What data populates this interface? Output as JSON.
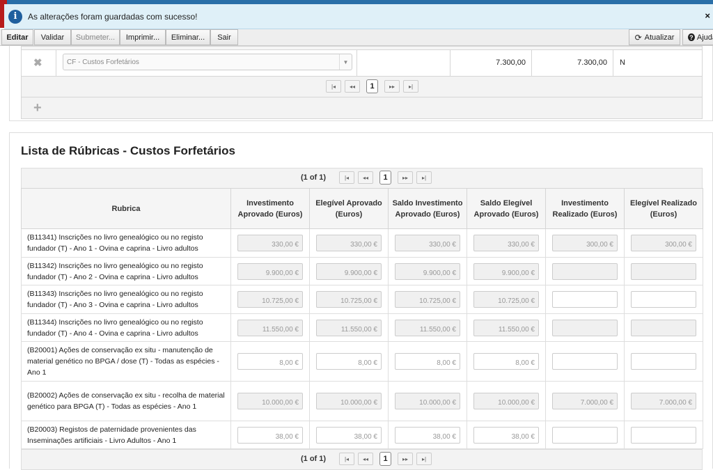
{
  "notification": {
    "message": "As alterações foram guardadas com sucesso!",
    "close": "×"
  },
  "toolbar": {
    "edit": "Editar",
    "validate": "Validar",
    "submit": "Submeter...",
    "print": "Imprimir...",
    "delete": "Eliminar...",
    "exit": "Sair",
    "refresh": "Atualizar",
    "help": "Ajuda"
  },
  "top_table": {
    "select_value": "CF - Custos Forfetários",
    "value_1": "7.300,00",
    "value_2": "7.300,00",
    "flag": "N",
    "pager": {
      "first": "|◂",
      "prev": "◂◂",
      "page": "1",
      "next": "▸▸",
      "last": "▸|"
    }
  },
  "section": {
    "title": "Lista de Rúbricas - Custos Forfetários"
  },
  "pager": {
    "label": "(1 of 1)",
    "first": "|◂",
    "prev": "◂◂",
    "page": "1",
    "next": "▸▸",
    "last": "▸|"
  },
  "grid": {
    "columns": [
      {
        "label": "Rubrica"
      },
      {
        "label": "Investimento Aprovado (Euros)"
      },
      {
        "label": "Elegível Aprovado (Euros)"
      },
      {
        "label": "Saldo Investimento Aprovado (Euros)"
      },
      {
        "label": "Saldo Elegível Aprovado (Euros)"
      },
      {
        "label": "Investimento Realizado (Euros)"
      },
      {
        "label": "Elegível Realizado (Euros)"
      }
    ],
    "rows": [
      {
        "rubrica": "(B11341) Inscrições no livro genealógico ou no registo fundador (T) - Ano 1 - Ovina e caprina - Livro adultos",
        "inv": "330,00 €",
        "eleg": "330,00 €",
        "saldo_inv": "330,00 €",
        "saldo_eleg": "330,00 €",
        "inv_real": "300,00 €",
        "eleg_real": "300,00 €"
      },
      {
        "rubrica": "(B11342) Inscrições no livro genealógico ou no registo fundador (T) - Ano 2 - Ovina e caprina - Livro adultos",
        "inv": "9.900,00 €",
        "eleg": "9.900,00 €",
        "saldo_inv": "9.900,00 €",
        "saldo_eleg": "9.900,00 €",
        "inv_real": "",
        "eleg_real": ""
      },
      {
        "rubrica": "(B11343) Inscrições no livro genealógico ou no registo fundador (T) - Ano 3 - Ovina e caprina - Livro adultos",
        "inv": "10.725,00 €",
        "eleg": "10.725,00 €",
        "saldo_inv": "10.725,00 €",
        "saldo_eleg": "10.725,00 €",
        "inv_real": "",
        "eleg_real": ""
      },
      {
        "rubrica": "(B11344) Inscrições no livro genealógico ou no registo fundador (T) - Ano 4 - Ovina e caprina - Livro adultos",
        "inv": "11.550,00 €",
        "eleg": "11.550,00 €",
        "saldo_inv": "11.550,00 €",
        "saldo_eleg": "11.550,00 €",
        "inv_real": "",
        "eleg_real": ""
      },
      {
        "rubrica": "(B20001) Ações de conservação ex situ - manutenção de material genético no BPGA / dose (T) - Todas as espécies - Ano 1",
        "inv": "8,00 €",
        "eleg": "8,00 €",
        "saldo_inv": "8,00 €",
        "saldo_eleg": "8,00 €",
        "inv_real": "",
        "eleg_real": ""
      },
      {
        "rubrica": "(B20002) Ações de conservação ex situ - recolha de material genético para BPGA (T) - Todas as espécies - Ano 1",
        "inv": "10.000,00 €",
        "eleg": "10.000,00 €",
        "saldo_inv": "10.000,00 €",
        "saldo_eleg": "10.000,00 €",
        "inv_real": "7.000,00 €",
        "eleg_real": "7.000,00 €"
      },
      {
        "rubrica": "(B20003) Registos de paternidade provenientes das Inseminações artificiais - Livro Adultos - Ano 1",
        "inv": "38,00 €",
        "eleg": "38,00 €",
        "saldo_inv": "38,00 €",
        "saldo_eleg": "38,00 €",
        "inv_real": "",
        "eleg_real": ""
      }
    ]
  }
}
